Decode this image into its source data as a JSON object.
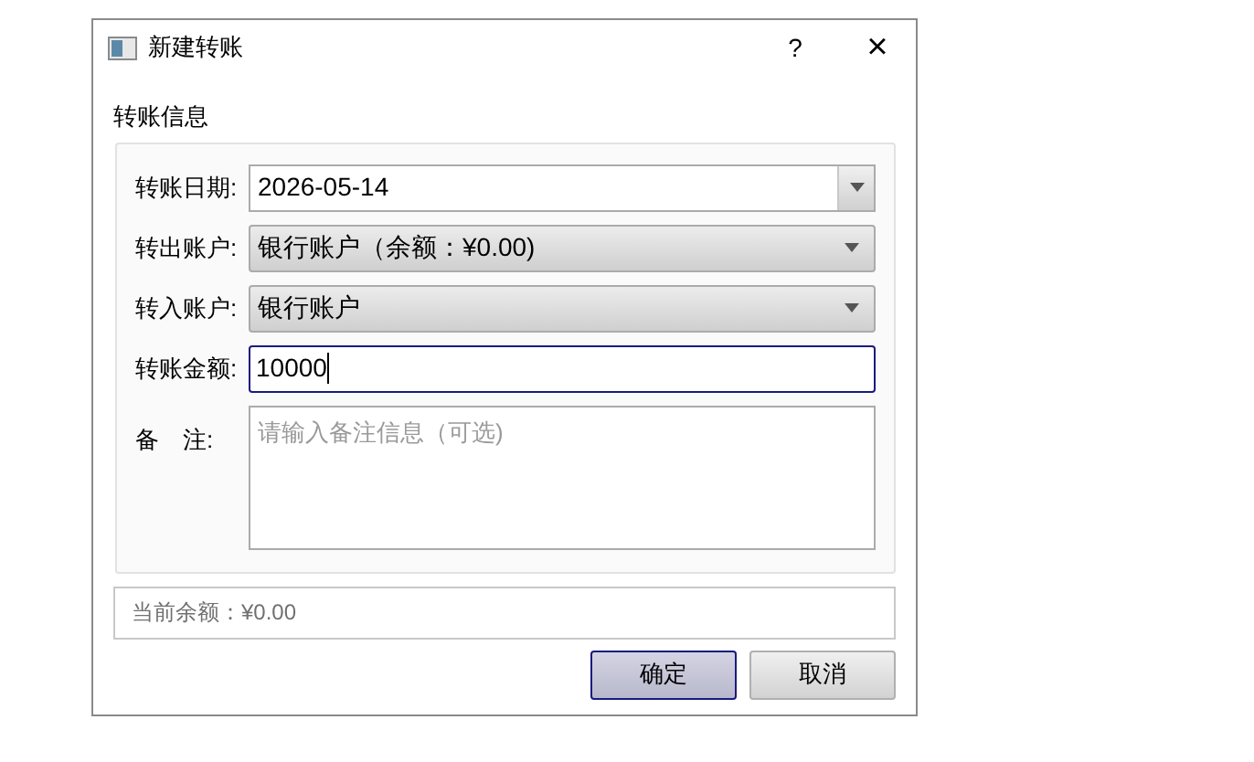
{
  "window": {
    "title": "新建转账",
    "help": "?",
    "close": "×"
  },
  "section_title": "转账信息",
  "fields": [
    {
      "kind": "date",
      "label": "转账日期:",
      "value": "2026-05-14",
      "focused": false
    },
    {
      "kind": "combo",
      "label": "转出账户:",
      "value": "银行账户（余额：¥0.00)",
      "focused": false
    },
    {
      "kind": "combo",
      "label": "转入账户:",
      "value": "银行账户",
      "focused": false
    },
    {
      "kind": "text",
      "label": "转账金额:",
      "value": "10000",
      "focused": true
    },
    {
      "kind": "textarea",
      "label": "备　注:",
      "placeholder": "请输入备注信息（可选)",
      "focused": false
    }
  ],
  "balance": "当前余额：¥0.00",
  "buttons": [
    {
      "label": "确定",
      "selected": true
    },
    {
      "label": "取消",
      "selected": false
    }
  ]
}
